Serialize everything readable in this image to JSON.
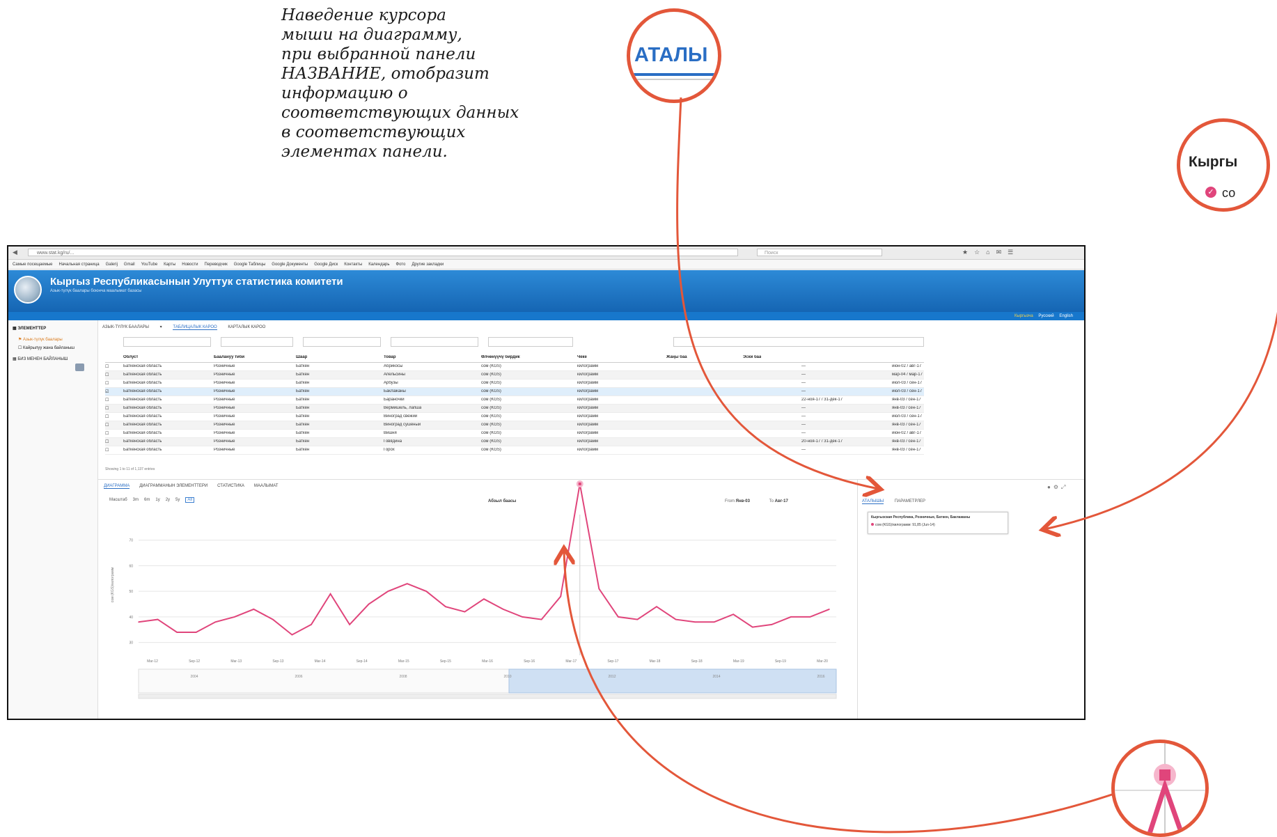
{
  "annotation": {
    "note": "Наведение курсора\nмыши на диаграмму,\nпри выбранной панели\nНАЗВАНИЕ, отобразит\nинформацию о\nсоответствующих данных\nв соответствующих\nэлементах панели."
  },
  "zoom_callouts": {
    "tab_fragment": "АТАЛЫ",
    "title_fragment": "Кыргы",
    "checkbox_fragment": "со"
  },
  "browser": {
    "url": "www.stat.kg/ru/...",
    "search_placeholder": "Поиск",
    "bookmarks": [
      "Самые посещаемые",
      "Начальная страница",
      "Galerij",
      "Gmail",
      "YouTube",
      "Карты",
      "Новости",
      "Переводчик",
      "Google Таблицы",
      "Google Документы",
      "Google Диск",
      "Контакты",
      "Календарь",
      "Фото",
      "Другие закладки"
    ]
  },
  "header": {
    "title": "Кыргыз Республикасынын Улуттук статистика комитети",
    "subtitle": "Азык-түлүк баалары боюнча маалымат базасы",
    "languages": {
      "active": "Кыргызча",
      "ru": "Русский",
      "en": "English"
    }
  },
  "sidebar": {
    "items": [
      {
        "label": "ЭЛЕМЕНТТЕР"
      },
      {
        "label": "Азык-түлүк баалары"
      },
      {
        "label": "Кайрылуу жана байланыш"
      },
      {
        "label": "БИЗ МЕНЕН БАЙЛАНЫШ"
      }
    ]
  },
  "main": {
    "tabs": {
      "dropdown": "АЗЫК-ТҮЛҮК БААЛАРЫ",
      "table": "ТАБЛИЦАЛЫК КАРОО",
      "map": "КАРТАЛЫК КАРОО"
    },
    "table": {
      "headers": [
        "Облуст",
        "Баалануу тиби",
        "Шаар",
        "Товар",
        "Өлчөнүүчү бирдик",
        "Чеке",
        "Жаңы баа",
        "Эски баа"
      ],
      "rows": [
        [
          "Баткенская область",
          "Розничные",
          "Баткен",
          "Абрикосы",
          "сом (KGS)",
          "килограмм",
          "—",
          "июн-02 / авг-17"
        ],
        [
          "Баткенская область",
          "Розничные",
          "Баткен",
          "Апельсины",
          "сом (KGS)",
          "килограмм",
          "—",
          "мар-04 / мар-17"
        ],
        [
          "Баткенская область",
          "Розничные",
          "Баткен",
          "Арбузы",
          "сом (KGS)",
          "килограмм",
          "—",
          "июл-03 / сен-17"
        ],
        [
          "Баткенская область",
          "Розничные",
          "Баткен",
          "Баклажаны",
          "сом (KGS)",
          "килограмм",
          "—",
          "июл-03 / сен-17"
        ],
        [
          "Баткенская область",
          "Розничные",
          "Баткен",
          "Бараночки",
          "сом (KGS)",
          "килограмм",
          "22-ноя-17 / 31-дек-17",
          "янв-03 / сен-17"
        ],
        [
          "Баткенская область",
          "Розничные",
          "Баткен",
          "Вермишель, лапша",
          "сом (KGS)",
          "килограмм",
          "—",
          "янв-03 / сен-17"
        ],
        [
          "Баткенская область",
          "Розничные",
          "Баткен",
          "Виноград свежий",
          "сом (KGS)",
          "килограмм",
          "—",
          "июл-03 / сен-17"
        ],
        [
          "Баткенская область",
          "Розничные",
          "Баткен",
          "Виноград сушеный",
          "сом (KGS)",
          "килограмм",
          "—",
          "янв-03 / сен-17"
        ],
        [
          "Баткенская область",
          "Розничные",
          "Баткен",
          "Вишня",
          "сом (KGS)",
          "килограмм",
          "—",
          "июн-02 / авг-17"
        ],
        [
          "Баткенская область",
          "Розничные",
          "Баткен",
          "Говядина",
          "сом (KGS)",
          "килограмм",
          "20-ноя-17 / 31-дек-17",
          "янв-03 / сен-17"
        ],
        [
          "Баткенская область",
          "Розничные",
          "Баткен",
          "Горох",
          "сом (KGS)",
          "килограмм",
          "—",
          "янв-03 / сен-17"
        ]
      ],
      "footer": "Showing 1 to 11 of 1,137 entries"
    }
  },
  "lower_panel": {
    "tabs": [
      "ДИАГРАММА",
      "ДИАГРАММАНЫН ЭЛЕМЕНТТЕРИ",
      "СТАТИСТИКА",
      "МААЛЫМАТ"
    ],
    "zoom": {
      "label": "Масштаб",
      "options": [
        "3m",
        "6m",
        "1y",
        "2y",
        "5y",
        "All"
      ],
      "active": "All"
    },
    "chart_title": "Абзыл баасы",
    "range": {
      "from_label": "From",
      "from": "Янв-03",
      "to_label": "To",
      "to": "Авг-17"
    },
    "navigator_labels": [
      "2004",
      "2006",
      "2008",
      "2010",
      "2012",
      "2014",
      "2016"
    ],
    "right_tabs": {
      "active": "АТАЛЫШЫ",
      "other": "ПАРАМЕТРЛЕР"
    },
    "tooltip": {
      "title": "Кыргызская Республика, Розничные, Баткен, Баклажаны",
      "value": "сом (KGS)/килограмм: 91,85 (Jun-14)"
    }
  },
  "colors": {
    "accent": "#2a6ec4",
    "series": "#e0457b",
    "callout": "#e3573a",
    "header": "#1769b8"
  },
  "chart_data": {
    "type": "line",
    "title": "Абзыл баасы",
    "xlabel": "",
    "ylabel": "сом (KGS)/килограмм",
    "x": [
      "Mar-12",
      "Jun-12",
      "Sep-12",
      "Dec-12",
      "Mar-13",
      "Jun-13",
      "Sep-13",
      "Dec-13",
      "Mar-14",
      "Jun-14",
      "Sep-14",
      "Dec-14",
      "Mar-15",
      "Jun-15",
      "Sep-15",
      "Dec-15",
      "Mar-16",
      "Jun-16",
      "Sep-16",
      "Dec-16",
      "Mar-17",
      "Jun-17"
    ],
    "series": [
      {
        "name": "сом (KGS)/килограмм",
        "values": [
          38,
          39,
          34,
          34,
          38,
          40,
          43,
          39,
          33,
          37,
          49,
          37,
          45,
          50,
          53,
          50,
          44,
          42,
          47,
          43,
          40,
          39,
          48,
          92,
          51,
          40,
          39,
          44,
          39,
          38,
          38,
          41,
          36,
          37,
          40,
          40,
          43
        ]
      }
    ],
    "x_ticks": [
      "Mar-12",
      "Sep-12",
      "Mar-13",
      "Sep-13",
      "Mar-14",
      "Sep-14",
      "Mar-15",
      "Sep-15",
      "Mar-16",
      "Sep-16",
      "Mar-17",
      "Sep-17",
      "Mar-18",
      "Sep-18",
      "Mar-19",
      "Sep-19",
      "Mar-20"
    ],
    "y_ticks": [
      "70",
      "60",
      "50",
      "40",
      "30"
    ],
    "ylim": [
      25,
      80
    ],
    "grid": true
  }
}
